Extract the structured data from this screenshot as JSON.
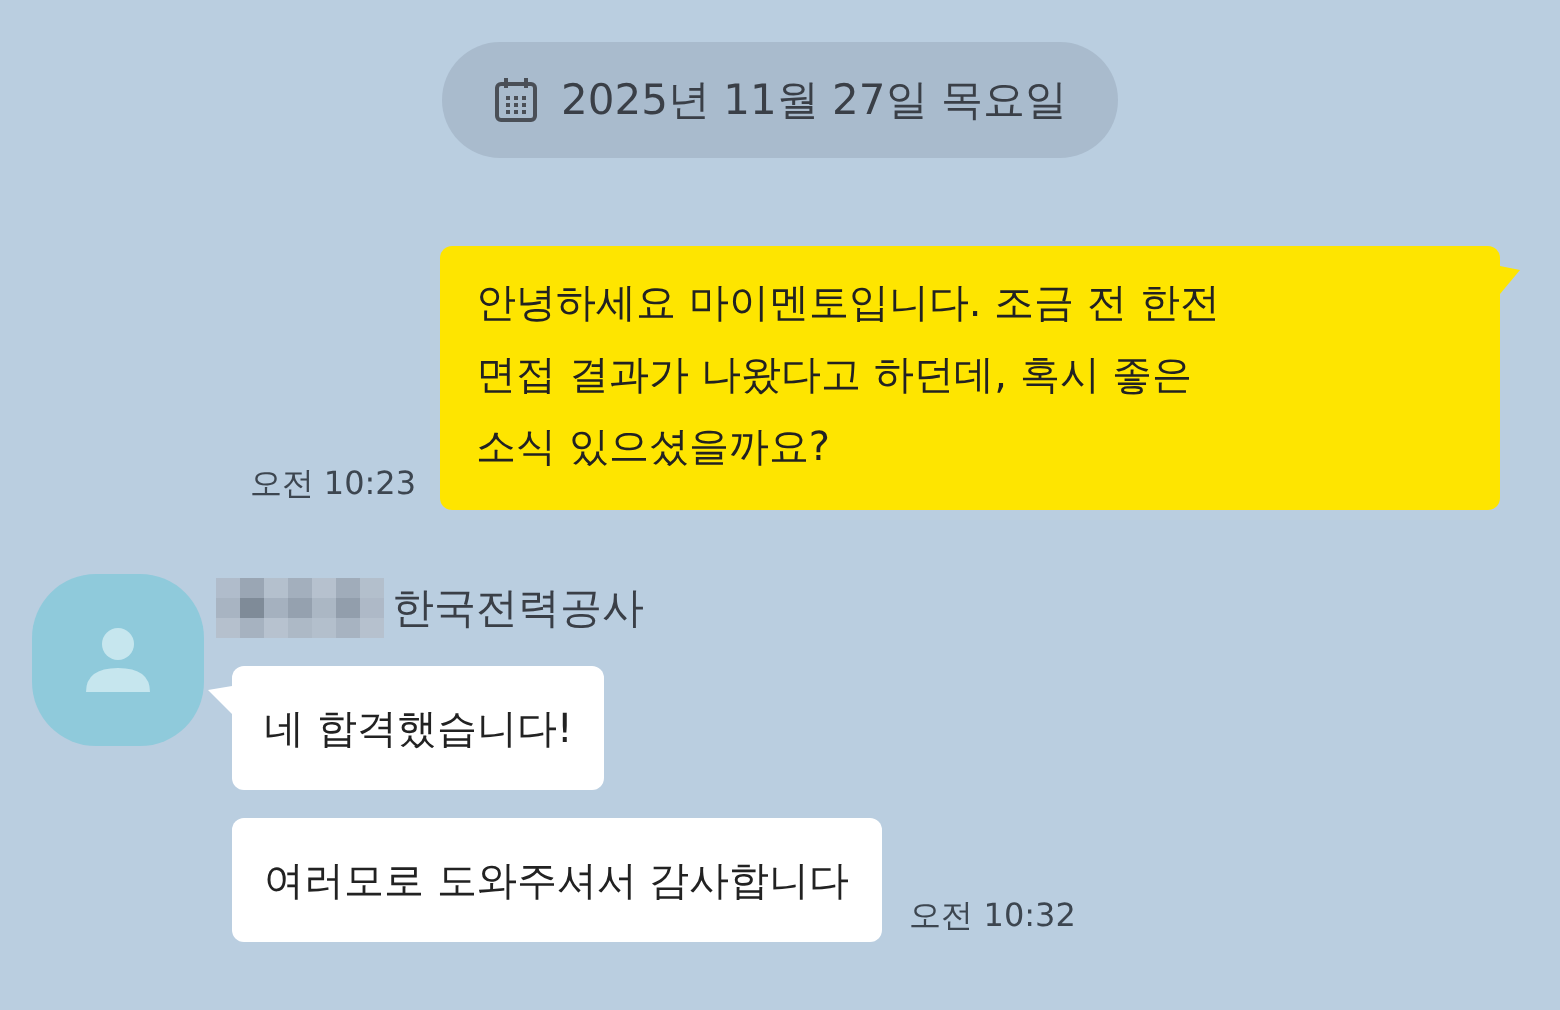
{
  "date_divider": {
    "text": "2025년 11월 27일 목요일"
  },
  "messages": [
    {
      "kind": "sent",
      "text": "안녕하세요 마이멘토입니다. 조금 전 한전\n면접 결과가 나왔다고 하던데, 혹시 좋은\n소식 있으셨을까요?",
      "time": "오전 10:23"
    },
    {
      "kind": "received",
      "sender": "한국전력공사",
      "bubbles": [
        "네 합격했습니다!",
        "여러모로 도와주셔서 감사합니다"
      ],
      "time": "오전 10:32"
    }
  ]
}
